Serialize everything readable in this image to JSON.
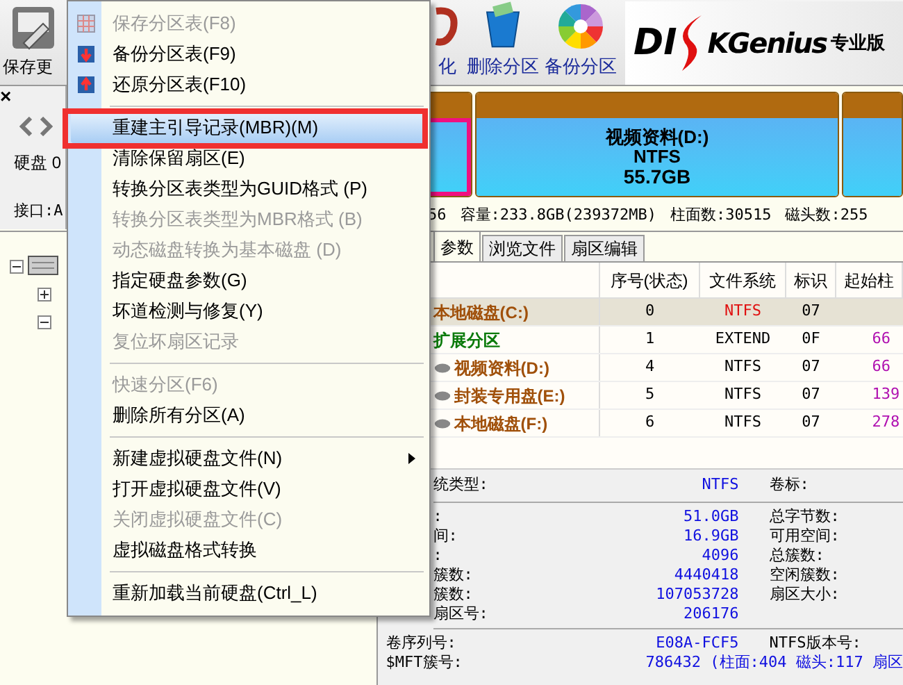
{
  "toolbar": {
    "buttons": [
      {
        "label": "保存更",
        "kind": "save"
      },
      {
        "label": "化",
        "kind": "format"
      },
      {
        "label": "删除分区",
        "kind": "delete"
      },
      {
        "label": "备份分区",
        "kind": "backup"
      }
    ],
    "logo": {
      "left": "DI",
      "right": "KGenius",
      "edition": "专业版"
    }
  },
  "disk_panel": {
    "label": "硬盘 0",
    "interface": "接口:A"
  },
  "partitions": [
    {
      "selected": true
    },
    {
      "selected": false,
      "name": "视频资料(D:)",
      "fs": "NTFS",
      "size": "55.7GB"
    },
    {
      "selected": false
    }
  ],
  "disk_info": [
    "56",
    "容量:233.8GB(239372MB)",
    "柱面数:30515",
    "磁头数:255"
  ],
  "tabs": [
    {
      "label": "参数",
      "selected": true
    },
    {
      "label": "浏览文件",
      "selected": false
    },
    {
      "label": "扇区编辑",
      "selected": false
    }
  ],
  "table": {
    "columns": [
      "序号(状态)",
      "文件系统",
      "标识",
      "起始柱"
    ],
    "rows": [
      {
        "kind": "primary",
        "selected": true,
        "name": "本地磁盘(C:)",
        "index": "0",
        "fs": "NTFS",
        "id": "07",
        "start": ""
      },
      {
        "kind": "extended",
        "selected": false,
        "name": "扩展分区",
        "index": "1",
        "fs": "EXTEND",
        "id": "0F",
        "start": "66"
      },
      {
        "kind": "logical",
        "selected": false,
        "name": "视频资料(D:)",
        "index": "4",
        "fs": "NTFS",
        "id": "07",
        "start": "66"
      },
      {
        "kind": "logical",
        "selected": false,
        "name": "封装专用盘(E:)",
        "index": "5",
        "fs": "NTFS",
        "id": "07",
        "start": "139"
      },
      {
        "kind": "logical",
        "selected": false,
        "name": "本地磁盘(F:)",
        "index": "6",
        "fs": "NTFS",
        "id": "07",
        "start": "278"
      }
    ]
  },
  "details": {
    "header": {
      "label": "统类型:",
      "value": "NTFS",
      "right_label": "卷标:"
    },
    "rows": [
      {
        "label": ":",
        "value": "51.0GB",
        "right_label": "总字节数:"
      },
      {
        "label": "间:",
        "value": "16.9GB",
        "right_label": "可用空间:"
      },
      {
        "label": ":",
        "value": "4096",
        "right_label": "总簇数:"
      },
      {
        "label": "簇数:",
        "value": "4440418",
        "right_label": "空闲簇数:"
      },
      {
        "label": "簇数:",
        "value": "107053728",
        "right_label": "扇区大小:"
      },
      {
        "label": "扇区号:",
        "value": "206176"
      }
    ],
    "footer": [
      {
        "label": "卷序列号:",
        "value": "E08A-FCF5",
        "right_label": "NTFS版本号:"
      },
      {
        "label": "$MFT簇号:",
        "value": "786432 (柱面:404 磁头:117 扇区"
      }
    ]
  },
  "close_glyph": "×",
  "menu": [
    {
      "kind": "item",
      "label": "保存分区表(F8)",
      "disabled": true
    },
    {
      "kind": "item",
      "label": "备份分区表(F9)",
      "disabled": false
    },
    {
      "kind": "item",
      "label": "还原分区表(F10)",
      "disabled": false
    },
    {
      "kind": "separator"
    },
    {
      "kind": "item",
      "label": "重建主引导记录(MBR)(M)",
      "disabled": false,
      "selected": true,
      "outlined": true
    },
    {
      "kind": "item",
      "label": "清除保留扇区(E)",
      "disabled": false
    },
    {
      "kind": "item",
      "label": "转换分区表类型为GUID格式 (P)",
      "disabled": false
    },
    {
      "kind": "item",
      "label": "转换分区表类型为MBR格式 (B)",
      "disabled": true
    },
    {
      "kind": "item",
      "label": "动态磁盘转换为基本磁盘 (D)",
      "disabled": true
    },
    {
      "kind": "item",
      "label": "指定硬盘参数(G)",
      "disabled": false
    },
    {
      "kind": "item",
      "label": "坏道检测与修复(Y)",
      "disabled": false
    },
    {
      "kind": "item",
      "label": "复位坏扇区记录",
      "disabled": true
    },
    {
      "kind": "separator"
    },
    {
      "kind": "item",
      "label": "快速分区(F6)",
      "disabled": true
    },
    {
      "kind": "item",
      "label": "删除所有分区(A)",
      "disabled": false
    },
    {
      "kind": "separator"
    },
    {
      "kind": "item",
      "label": "新建虚拟硬盘文件(N)",
      "disabled": false,
      "submenu": true
    },
    {
      "kind": "item",
      "label": "打开虚拟硬盘文件(V)",
      "disabled": false
    },
    {
      "kind": "item",
      "label": "关闭虚拟硬盘文件(C)",
      "disabled": true
    },
    {
      "kind": "item",
      "label": "虚拟磁盘格式转换",
      "disabled": false
    },
    {
      "kind": "separator"
    },
    {
      "kind": "item",
      "label": "重新加载当前硬盘(Ctrl_L)",
      "disabled": false
    }
  ]
}
